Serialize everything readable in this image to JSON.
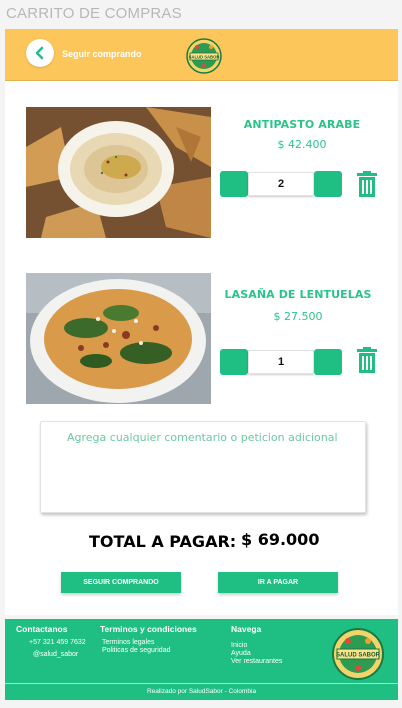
{
  "page": {
    "title": "CARRITO DE COMPRAS"
  },
  "header": {
    "back_label": "Seguir comprando",
    "back_icon": "chevron-left-icon",
    "logo_text": "SALUD SABOR"
  },
  "cart": {
    "items": [
      {
        "name": "ANTIPASTO ARABE",
        "price": "$ 42.400",
        "quantity": "2",
        "image": "hummus-dish-photo"
      },
      {
        "name": "LASAÑA DE LENTUELAS",
        "price": "$ 27.500",
        "quantity": "1",
        "image": "pasta-dish-photo"
      }
    ]
  },
  "comment": {
    "placeholder": "Agrega cualquier comentario o peticion adicional"
  },
  "total": {
    "label": "TOTAL A PAGAR:",
    "value": "$ 69.000"
  },
  "actions": {
    "continue_label": "SEGUIR COMPRANDO",
    "pay_label": "IR A PAGAR"
  },
  "footer": {
    "contact": {
      "heading": "Contactanos",
      "phone": "+57 321 459 7632",
      "handle": "@salud_sabor"
    },
    "terms": {
      "heading": "Terminos y condiciones",
      "legal": "Terminos legales",
      "security": "Politicas de seguridad"
    },
    "nav": {
      "heading": "Navega",
      "home": "Inicio",
      "help": "Ayuda",
      "restaurants": "Ver restaurantes"
    },
    "credit": "Realizado por SaludSabor - Colombia",
    "logo_text": "SALUD SABOR"
  },
  "colors": {
    "brand_green": "#1fbf83",
    "header_yellow": "#fdc65a",
    "text_green": "#2ac48a"
  }
}
